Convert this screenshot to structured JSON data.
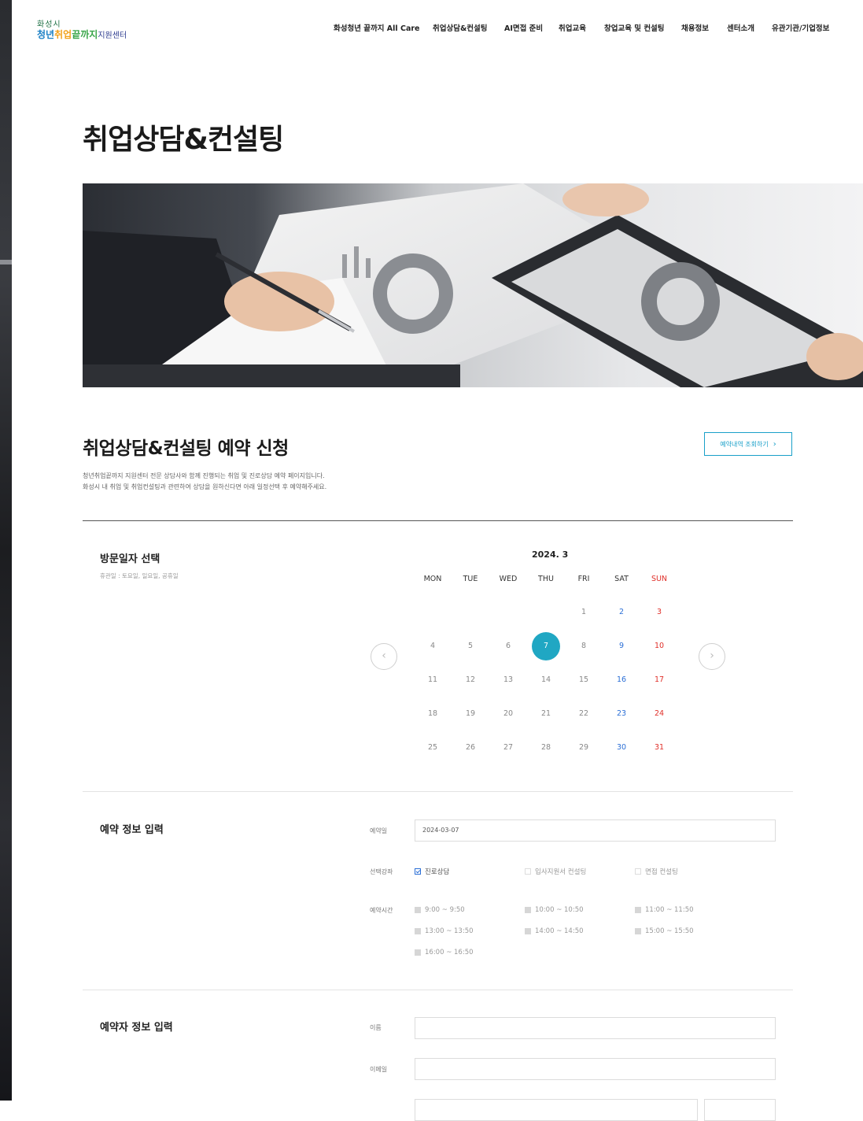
{
  "header": {
    "logo_line1": "화성시",
    "logo_part1": "청년",
    "logo_part2": "취업",
    "logo_part3": "끝까지",
    "logo_part4": "지원센터",
    "nav": [
      "화성청년 끝까지 All Care",
      "취업상담&컨설팅",
      "AI면접 준비",
      "취업교육",
      "창업교육 및 컨설팅",
      "채용정보",
      "센터소개",
      "유관기관/기업정보"
    ]
  },
  "page_title": "취업상담&컨설팅",
  "reservation": {
    "title": "취업상담&컨설팅 예약 신청",
    "lookup_button": "예약내역 조회하기",
    "desc_line1": "청년취업끝까지 지원센터 전문 상담사와 함께 진행되는 취업 및 진로상담 예약 페이지입니다.",
    "desc_line2": "화성시 내 취업 및 취업컨설팅과 관련하여 상담을 원하신다면 아래 일정선택 후 예약해주세요."
  },
  "visit_date": {
    "title": "방문일자 선택",
    "note": "휴관일 : 토요일, 일요일, 공휴일"
  },
  "calendar": {
    "month": "2024. 3",
    "weekdays": [
      "MON",
      "TUE",
      "WED",
      "THU",
      "FRI",
      "SAT",
      "SUN"
    ],
    "weeks": [
      [
        "",
        "",
        "",
        "",
        "1",
        "2",
        "3"
      ],
      [
        "4",
        "5",
        "6",
        "7",
        "8",
        "9",
        "10"
      ],
      [
        "11",
        "12",
        "13",
        "14",
        "15",
        "16",
        "17"
      ],
      [
        "18",
        "19",
        "20",
        "21",
        "22",
        "23",
        "24"
      ],
      [
        "25",
        "26",
        "27",
        "28",
        "29",
        "30",
        "31"
      ]
    ],
    "selected_day": "7",
    "prev_icon": "‹",
    "next_icon": "›",
    "colors": {
      "selected": "#20a7c3",
      "saturday": "#2b6fd6",
      "sunday": "#e0302a"
    }
  },
  "booking_info": {
    "title": "예약 정보 입력",
    "date_label": "예약일",
    "date_value": "2024-03-07",
    "course_label": "선택강좌",
    "courses": [
      {
        "label": "진로상담",
        "checked": true
      },
      {
        "label": "입사지원서 컨설팅",
        "checked": false
      },
      {
        "label": "면접 컨설팅",
        "checked": false
      }
    ],
    "time_label": "예약시간",
    "times": [
      "9:00 ~ 9:50",
      "10:00 ~ 10:50",
      "11:00 ~ 11:50",
      "13:00 ~ 13:50",
      "14:00 ~ 14:50",
      "15:00 ~ 15:50",
      "16:00 ~ 16:50"
    ]
  },
  "booker_info": {
    "title": "예약자 정보 입력",
    "name_label": "이름",
    "name_value": "",
    "email_label": "이메일",
    "email_value": ""
  }
}
